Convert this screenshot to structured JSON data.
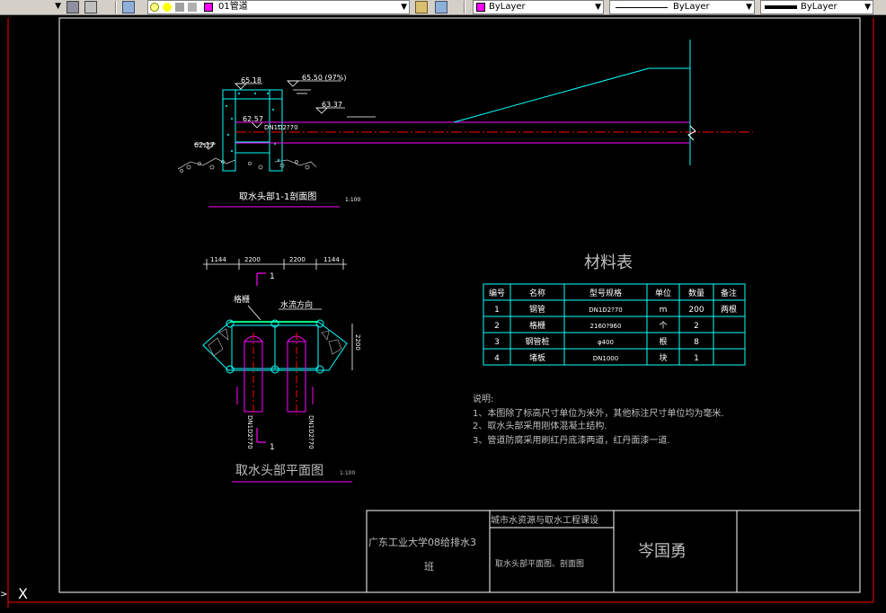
{
  "toolbar": {
    "left_arrow": "▼",
    "layer_value": "01管道",
    "layer_color": "#ff00ff",
    "color_value": "ByLayer",
    "color_swatch": "#ff00ff",
    "linetype_value": "ByLayer",
    "lineweight_value": "ByLayer"
  },
  "colors": {
    "drawing_bg": "#000000",
    "frame": "#ffffff",
    "sheet_border": "#ff0000",
    "cyan": "#00ffff",
    "magenta": "#ff00ff",
    "gray_text": "#bfbfbf"
  },
  "section": {
    "elev_65_18": "65.18",
    "elev_65_50": "65.50 (97%)",
    "elev_62_57": "62.57",
    "elev_63_37": "63.37",
    "elev_62_17": "62.17",
    "pipe_label": "DN1D2?70",
    "title": "取水头部1-1剖面图",
    "scale": "1:100"
  },
  "plan": {
    "dim_1": "1144",
    "dim_2": "2200",
    "dim_3": "2200",
    "dim_4": "1144",
    "dim_right": "2200",
    "grid_label": "格栅",
    "flow_label": "水流方向",
    "section_mark_top": "1",
    "section_mark_bottom": "1",
    "pipe_label_left": "DN1D2?70",
    "pipe_label_right": "DN1D2?70",
    "title": "取水头部平面图",
    "scale": "1:100"
  },
  "materials": {
    "title": "材料表",
    "headers": [
      "编号",
      "名称",
      "型号规格",
      "单位",
      "数量",
      "备注"
    ],
    "rows": [
      [
        "1",
        "钢管",
        "DN1D2?70",
        "m",
        "200",
        "两根"
      ],
      [
        "2",
        "格栅",
        "2160?960",
        "个",
        "2",
        ""
      ],
      [
        "3",
        "钢管桩",
        "φ400",
        "根",
        "8",
        ""
      ],
      [
        "4",
        "堵板",
        "DN1000",
        "块",
        "1",
        ""
      ]
    ]
  },
  "notes": {
    "heading": "说明:",
    "items": [
      "1、本图除了标高尺寸单位为米外，其他标注尺寸单位均为毫米.",
      "2、取水头部采用刚体混凝土结构.",
      "3、管道防腐采用刷红丹底漆两道，红丹面漆一道."
    ]
  },
  "title_block": {
    "school": "广东工业大学08给排水3",
    "school_line2": "班",
    "course": "城市水资源与取水工程课设",
    "drawing_name": "取水头部平面图、剖面图",
    "author": "岑国勇"
  },
  "ucs": {
    "x_label": "X",
    "arrow": ">"
  }
}
